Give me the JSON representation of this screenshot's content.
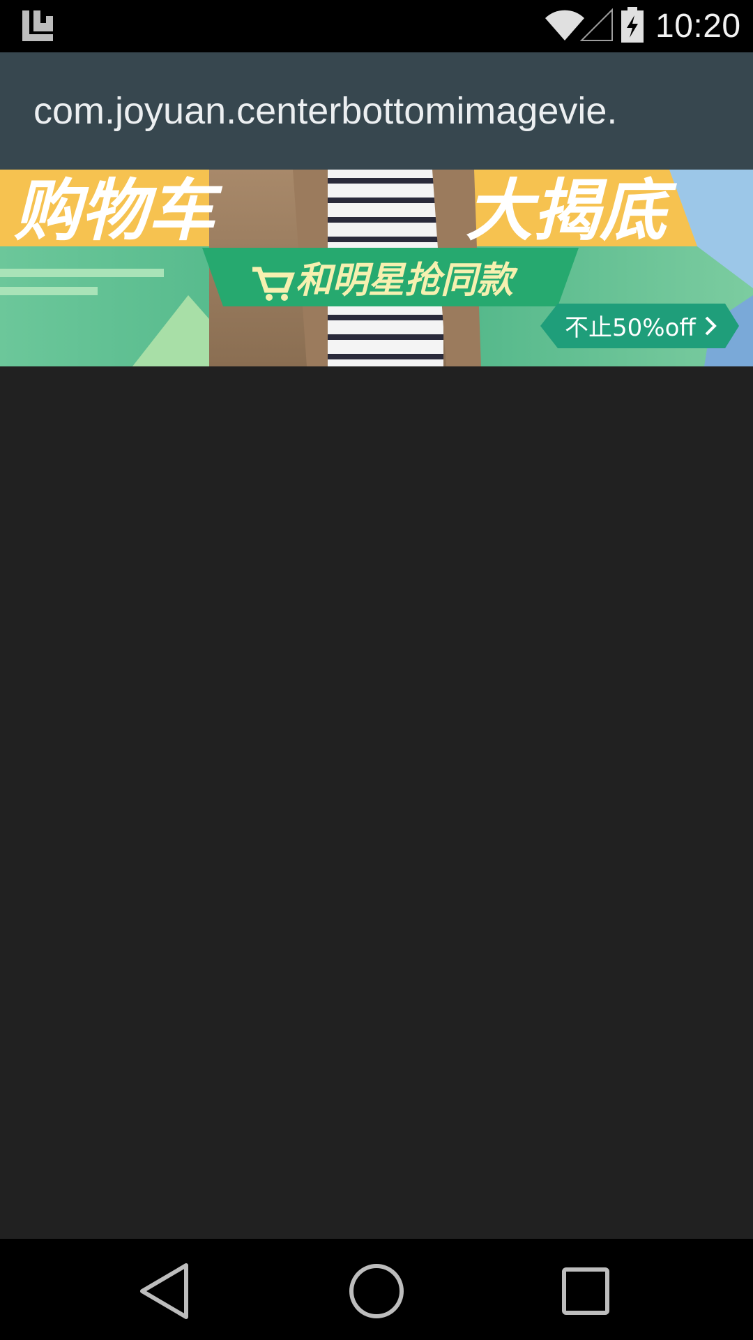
{
  "status_bar": {
    "time": "10:20",
    "icons": [
      "notification-app-icon",
      "wifi-icon",
      "signal-icon",
      "battery-charging-icon"
    ]
  },
  "app_bar": {
    "title": "com.joyuan.centerbottomimagevie."
  },
  "banner": {
    "headline_left": "购物车",
    "headline_right": "大揭底",
    "subtitle": "和明星抢同款",
    "badge": "不止50%off",
    "icons": [
      "cart-icon",
      "chevron-right-icon"
    ]
  },
  "nav_bar": {
    "icons": [
      "back-icon",
      "home-icon",
      "recents-icon"
    ]
  },
  "colors": {
    "status_bar": "#000000",
    "app_bar": "#37474f",
    "content_background": "#212121",
    "banner_green": "#3aa57a",
    "banner_yellow": "#f6c250"
  }
}
